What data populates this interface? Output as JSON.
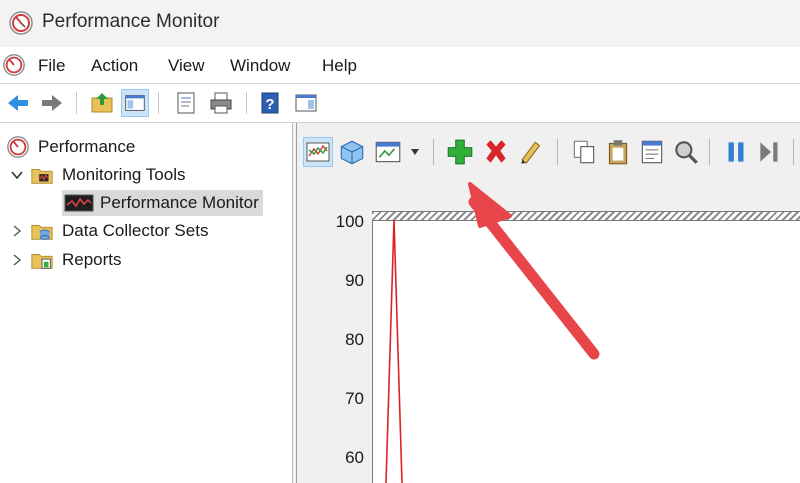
{
  "window": {
    "title": "Performance Monitor"
  },
  "menu": {
    "items": [
      "File",
      "Action",
      "View",
      "Window",
      "Help"
    ]
  },
  "tree": {
    "root": "Performance",
    "items": [
      {
        "label": "Monitoring Tools",
        "expanded": true
      },
      {
        "label": "Performance Monitor",
        "selected": true
      },
      {
        "label": "Data Collector Sets",
        "expanded": false
      },
      {
        "label": "Reports",
        "expanded": false
      }
    ]
  },
  "graph": {
    "y_ticks": [
      "100",
      "90",
      "80",
      "70",
      "60"
    ]
  },
  "chart_data": {
    "type": "line",
    "ylim": [
      0,
      100
    ],
    "y_ticks": [
      100,
      90,
      80,
      70,
      60
    ],
    "series": [
      {
        "color": "#e02020",
        "values": [
          0,
          100,
          45
        ]
      }
    ]
  },
  "colors": {
    "accent_arrow": "#e8454a",
    "add_counter": "#2fae3a",
    "delete_counter": "#d9262b",
    "selection": "#d9d9d9"
  },
  "icons": {
    "app": "performance-monitor-icon",
    "add": "add-counter-icon",
    "delete": "delete-counter-icon"
  }
}
